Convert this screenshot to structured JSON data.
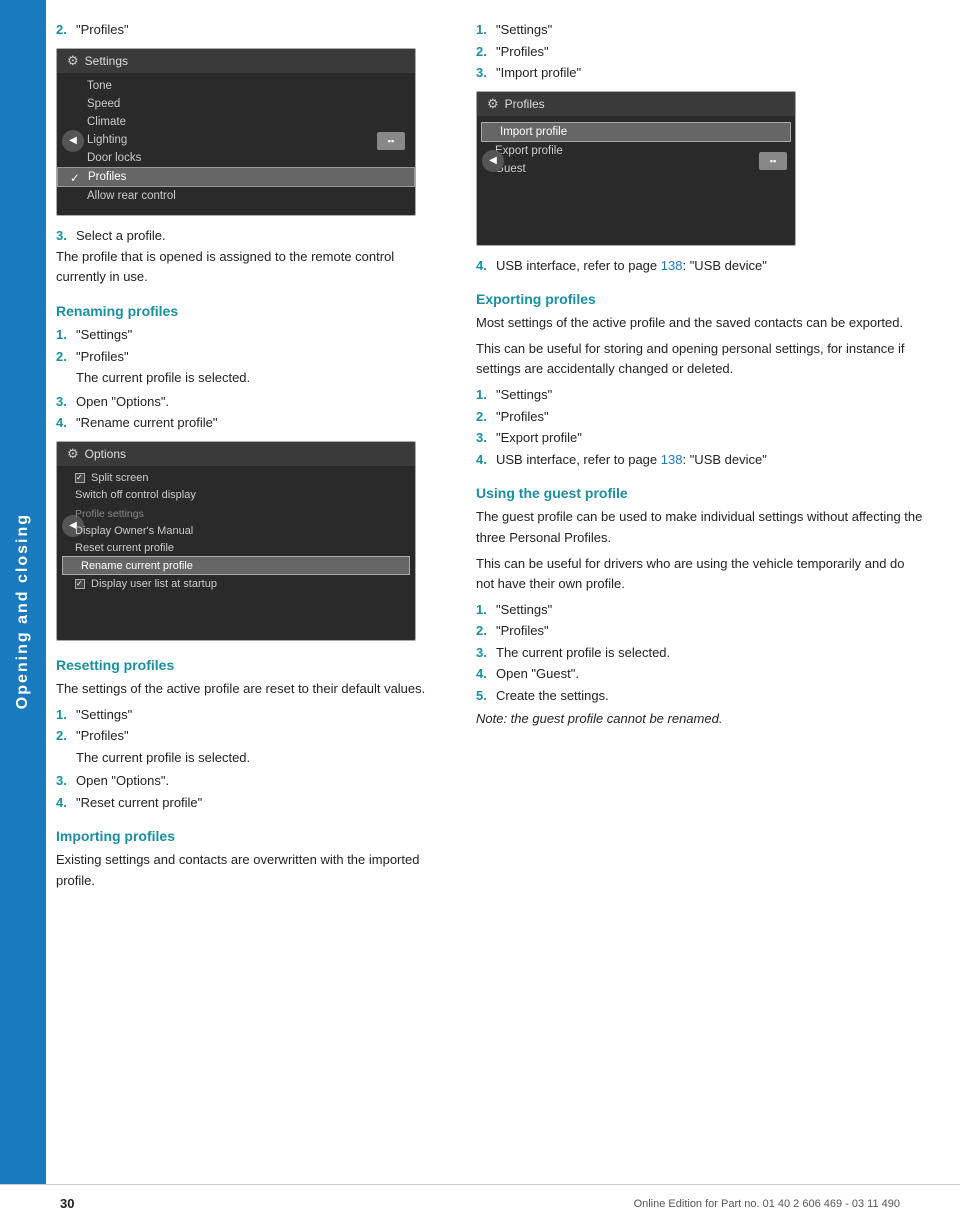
{
  "sidebar": {
    "text": "Opening and closing"
  },
  "page_number": "30",
  "bottom_footer": "Online Edition for Part no. 01 40 2 606 469 - 03 11 490",
  "left_column": {
    "step2_label": "\"Profiles\"",
    "settings_screen": {
      "title": "Settings",
      "items": [
        "Tone",
        "Speed",
        "Climate",
        "Lighting",
        "Door locks",
        "Profiles",
        "Allow rear control"
      ],
      "selected_item": "Profiles"
    },
    "step3_text": "Select a profile.",
    "para1": "The profile that is opened is assigned to the remote control currently in use.",
    "renaming_profiles": {
      "title": "Renaming profiles",
      "steps": [
        {
          "num": "1.",
          "text": "\"Settings\""
        },
        {
          "num": "2.",
          "text": "\"Profiles\""
        },
        {
          "indent": "The current profile is selected."
        },
        {
          "num": "3.",
          "text": "Open \"Options\"."
        },
        {
          "num": "4.",
          "text": "\"Rename current profile\""
        }
      ],
      "options_screen": {
        "title": "Options",
        "items": [
          {
            "type": "checkbox",
            "checked": true,
            "label": "Split screen"
          },
          {
            "type": "plain",
            "label": "Switch off control display"
          },
          {
            "type": "section",
            "label": "Profile settings"
          },
          {
            "type": "plain",
            "label": "Display Owner's Manual"
          },
          {
            "type": "plain",
            "label": "Reset current profile"
          },
          {
            "type": "highlighted",
            "label": "Rename current profile"
          },
          {
            "type": "checkbox",
            "checked": true,
            "label": "Display user list at startup"
          }
        ]
      }
    },
    "resetting_profiles": {
      "title": "Resetting profiles",
      "para": "The settings of the active profile are reset to their default values.",
      "steps": [
        {
          "num": "1.",
          "text": "\"Settings\""
        },
        {
          "num": "2.",
          "text": "\"Profiles\""
        },
        {
          "indent": "The current profile is selected."
        },
        {
          "num": "3.",
          "text": "Open \"Options\"."
        },
        {
          "num": "4.",
          "text": "\"Reset current profile\""
        }
      ]
    },
    "importing_profiles": {
      "title": "Importing profiles",
      "para": "Existing settings and contacts are overwritten with the imported profile."
    }
  },
  "right_column": {
    "import_steps": [
      {
        "num": "1.",
        "text": "\"Settings\""
      },
      {
        "num": "2.",
        "text": "\"Profiles\""
      },
      {
        "num": "3.",
        "text": "\"Import profile\""
      }
    ],
    "profiles_screen": {
      "title": "Profiles",
      "items": [
        "Import profile",
        "Export profile",
        "Guest"
      ],
      "highlighted_item": "Import profile"
    },
    "step4_text": "USB interface, refer to page ",
    "step4_link": "138",
    "step4_suffix": ": \"USB device\"",
    "exporting_profiles": {
      "title": "Exporting profiles",
      "para1": "Most settings of the active profile and the saved contacts can be exported.",
      "para2": "This can be useful for storing and opening personal settings, for instance if settings are accidentally changed or deleted.",
      "steps": [
        {
          "num": "1.",
          "text": "\"Settings\""
        },
        {
          "num": "2.",
          "text": "\"Profiles\""
        },
        {
          "num": "3.",
          "text": "\"Export profile\""
        },
        {
          "num": "4.",
          "text_before": "USB interface, refer to page ",
          "link": "138",
          "text_after": ": \"USB device\""
        }
      ]
    },
    "using_guest_profile": {
      "title": "Using the guest profile",
      "para1": "The guest profile can be used to make individual settings without affecting the three Personal Profiles.",
      "para2": "This can be useful for drivers who are using the vehicle temporarily and do not have their own profile.",
      "steps": [
        {
          "num": "1.",
          "text": "\"Settings\""
        },
        {
          "num": "2.",
          "text": "\"Profiles\""
        },
        {
          "num": "3.",
          "text": "The current profile is selected."
        },
        {
          "num": "4.",
          "text": "Open \"Guest\"."
        },
        {
          "num": "5.",
          "text": "Create the settings."
        }
      ],
      "note": "Note: the guest profile cannot be renamed."
    }
  }
}
